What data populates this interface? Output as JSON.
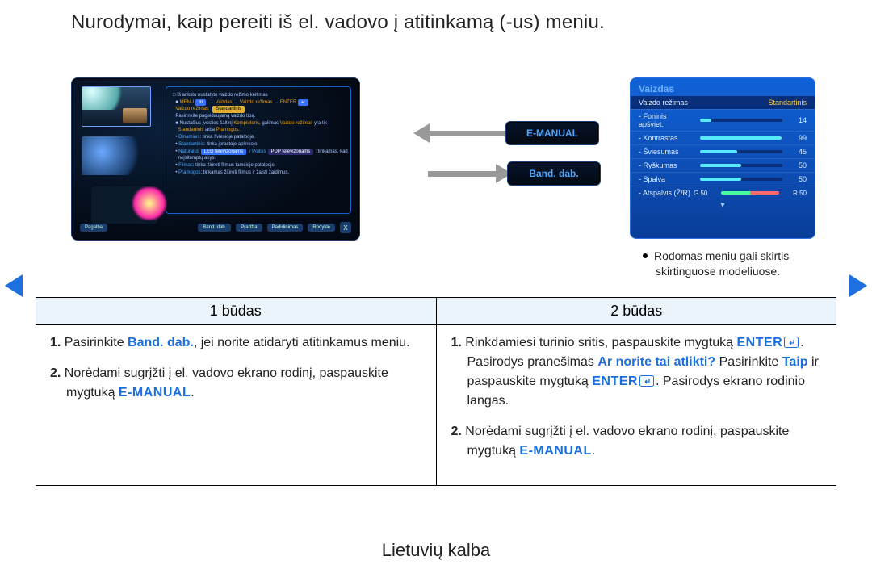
{
  "title": "Nurodymai, kaip pereiti iš el. vadovo į atitinkamą (-us) meniu.",
  "lang_footer": "Lietuvių kalba",
  "center_buttons": {
    "emanual": "E-MANUAL",
    "banddab": "Band. dab."
  },
  "emanual_panel": {
    "heading": "Iš anksto nustatyto vaizdo režimo keitimas",
    "menu_path": {
      "prefix": "MENU",
      "arrow": "→",
      "items": [
        "Vaizdas",
        "Vaizdo režimas",
        "ENTER"
      ]
    },
    "line3_label": "Vaizdo režimas:",
    "line3_badge": "Standartinis",
    "line4": "Pasirinkite pageidaujamą vaizdo tipą.",
    "line5_a": "Nustačius įvesties šaltinį",
    "line5_comp": "Kompiuteris",
    "line5_b": ", galimas",
    "line5_vrez": "Vaizdo režimas",
    "line5_c": "yra tik",
    "line6_a": "Standartinis",
    "line6_b": "arba",
    "line6_c": "Pramogos",
    "bullets": [
      {
        "label": "Dinaminis",
        "text": ": tinka šviesioje patalpoje."
      },
      {
        "label": "Standartinis",
        "text": ": tinka įprastoje aplinkoje."
      },
      {
        "label": "Natūralus",
        "pill1": "LED televizoriams",
        "mid": " / Poilsis",
        "pill2": "PDP televizoriams",
        "text": ": tinkamas, kad"
      },
      {
        "text_only": "neįsitemptų akys."
      },
      {
        "label": "Filmas",
        "text": ": tinka žiūrėti filmus tamsioje patalpoje."
      },
      {
        "label": "Pramogos",
        "text": ": tinkamas žiūrėti filmus ir žaisti žaidimus."
      }
    ],
    "footer": {
      "left": "Pagalba",
      "btns": [
        "Band. dab.",
        "Pradžia",
        "Padidinimas",
        "Rodyklė"
      ],
      "close": "X"
    }
  },
  "menu_card": {
    "title": "Vaizdas",
    "head_left": "Vaizdo režimas",
    "head_right": "Standartinis",
    "rows": [
      {
        "label": "Foninis apšviet.",
        "val": "14",
        "pct": "s14"
      },
      {
        "label": "Kontrastas",
        "val": "99",
        "pct": "s99"
      },
      {
        "label": "Šviesumas",
        "val": "45",
        "pct": "s45"
      },
      {
        "label": "Ryškumas",
        "val": "50",
        "pct": "s50"
      },
      {
        "label": "Spalva",
        "val": "50",
        "pct": "s50"
      }
    ],
    "tint": {
      "label": "Atspalvis (Ž/R)",
      "g": "G 50",
      "r": "R 50"
    }
  },
  "menu_note": "Rodomas meniu gali skirtis skirtinguose modeliuose.",
  "methods": {
    "col1": {
      "title": "1 būdas",
      "p1": {
        "no": "1.",
        "pre": "Pasirinkite ",
        "em": "Band. dab.",
        "post": ", jei norite atidaryti atitinkamus meniu."
      },
      "p2": {
        "no": "2.",
        "pre": "Norėdami sugrįžti į el. vadovo ekrano rodinį, paspauskite mygtuką ",
        "em": "E-MANUAL",
        "post": "."
      }
    },
    "col2": {
      "title": "2 būdas",
      "p1": {
        "no": "1.",
        "pre": "Rinkdamiesi turinio sritis, paspauskite mygtuką ",
        "enter1": "ENTER",
        "mid1": ". Pasirodys pranešimas ",
        "q": "Ar norite tai atlikti?",
        "mid2": " Pasirinkite ",
        "taip": "Taip",
        "mid3": " ir paspauskite mygtuką ",
        "enter2": "ENTER",
        "post": ". Pasirodys ekrano rodinio langas."
      },
      "p2": {
        "no": "2.",
        "pre": "Norėdami sugrįžti į el. vadovo ekrano rodinį, paspauskite mygtuką ",
        "em": "E-MANUAL",
        "post": "."
      }
    }
  }
}
